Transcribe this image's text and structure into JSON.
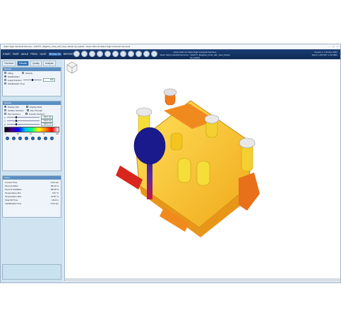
{
  "window": {
    "title": "Static Sight Industrial Services - NAVITT_Magsize_Final_with_New_Model (3)_leaked - Hosts 2021 01 [Static Sight Industrial Services]"
  },
  "menubar": {
    "menus": [
      "START",
      "PART",
      "MOLD",
      "PROC",
      "GATE",
      "RESULTS",
      "REPORT"
    ],
    "active_menu": "RESULTS",
    "center_line1": "Hosts 2021 01 Static Sight Industrial Services",
    "center_line2": "Static Sight Industrial Services - NAVITT_Magsize_Final_with_New_Model (3)_leaked",
    "right_line1": "Version 1.7   04 Dec 2021",
    "right_line2": "Spent 1,234,567   1.23 MB/s"
  },
  "left_panel": {
    "tabs": [
      "Overview",
      "Results",
      "Quality",
      "Analysis"
    ],
    "active_tab": "Results",
    "results": {
      "header": "Results",
      "options": [
        "Filling",
        "Velocity",
        "Solidification",
        "Liquid Fraction",
        "Solidification Time"
      ],
      "liquid_value": "0.50"
    },
    "display": {
      "header": "Display",
      "options": [
        "Display Part",
        "Display Mold",
        "Surface Sections",
        "See Through",
        "Part Sections",
        "Smooth Sections"
      ],
      "fields": [
        {
          "label": "X",
          "value": "100.0 mm"
        },
        {
          "label": "Y",
          "value": "100.0 mm"
        },
        {
          "label": "Z",
          "value": "100.0 mm"
        }
      ],
      "legend_ticks": [
        "0",
        "25",
        "50",
        "75",
        "100"
      ]
    },
    "stats": {
      "header": "Notes",
      "rows": [
        {
          "label": "Current Time",
          "value": "3.62 sec"
        },
        {
          "label": "Percent Filled",
          "value": "98.32 %"
        },
        {
          "label": "Percent Solidified",
          "value": "88.56 %"
        },
        {
          "label": "Temperature Min",
          "value": "720 °C"
        },
        {
          "label": "Temperature Max",
          "value": "1478 °C"
        },
        {
          "label": "Total Fill Time",
          "value": "18.22 s"
        },
        {
          "label": "Solidification time",
          "value": "3.62 sec"
        }
      ]
    }
  },
  "colors": {
    "accent": "#1a3d73",
    "part_yellow": "#f0c419",
    "part_orange": "#e8701a",
    "part_red": "#d9261c",
    "sprue_blue": "#1a1a8c"
  }
}
